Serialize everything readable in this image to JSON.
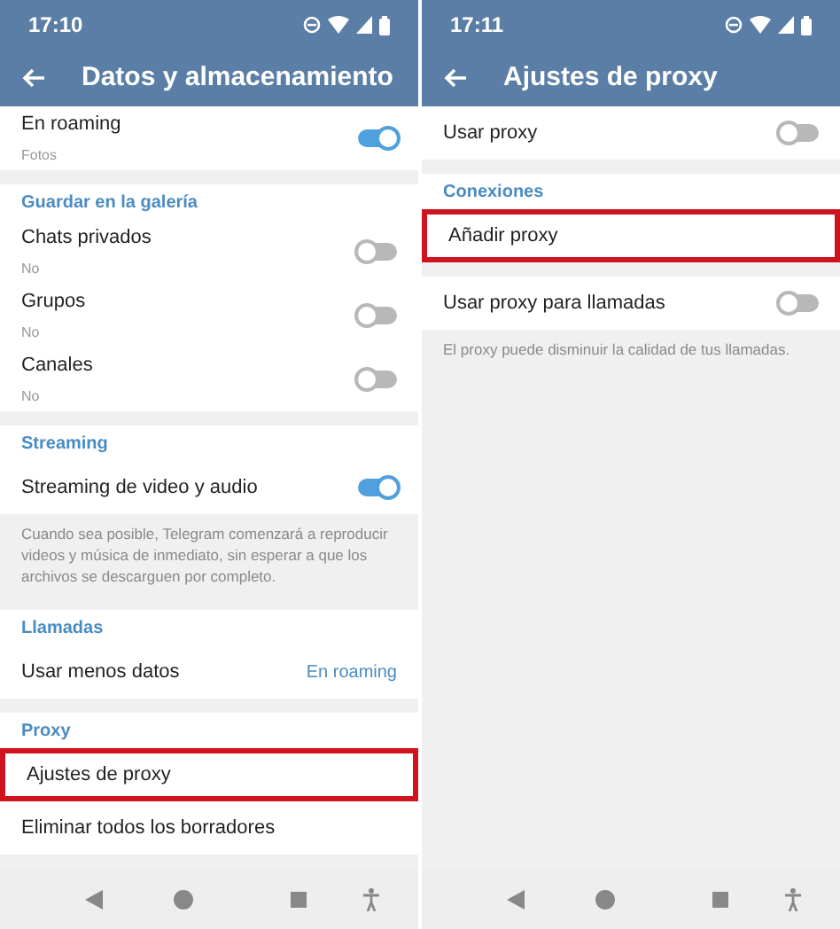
{
  "screens": [
    {
      "status_time": "17:10",
      "title": "Datos y almacenamiento",
      "sections": [
        {
          "rows": [
            {
              "kind": "toggle",
              "label": "En roaming",
              "sub": "Fotos",
              "on": true,
              "highlighted": false
            }
          ]
        },
        {
          "header": "Guardar en la galería",
          "rows": [
            {
              "kind": "toggle",
              "label": "Chats privados",
              "sub": "No",
              "on": false,
              "highlighted": false
            },
            {
              "kind": "toggle",
              "label": "Grupos",
              "sub": "No",
              "on": false,
              "highlighted": false
            },
            {
              "kind": "toggle",
              "label": "Canales",
              "sub": "No",
              "on": false,
              "highlighted": false
            }
          ]
        },
        {
          "header": "Streaming",
          "rows": [
            {
              "kind": "toggle",
              "label": "Streaming de video y audio",
              "on": true,
              "highlighted": false
            }
          ],
          "footer": "Cuando sea posible, Telegram comenzará a reproducir videos y música de inmediato, sin esperar a que los archivos se descarguen por completo."
        },
        {
          "header": "Llamadas",
          "rows": [
            {
              "kind": "value",
              "label": "Usar menos datos",
              "value": "En roaming",
              "highlighted": false
            }
          ]
        },
        {
          "header": "Proxy",
          "rows": [
            {
              "kind": "plain",
              "label": "Ajustes de proxy",
              "highlighted": true
            },
            {
              "kind": "plain",
              "label": "Eliminar todos los borradores",
              "highlighted": false
            }
          ]
        }
      ]
    },
    {
      "status_time": "17:11",
      "title": "Ajustes de proxy",
      "sections": [
        {
          "rows": [
            {
              "kind": "toggle",
              "label": "Usar proxy",
              "on": false,
              "highlighted": false
            }
          ]
        },
        {
          "header": "Conexiones",
          "rows": [
            {
              "kind": "plain",
              "label": "Añadir proxy",
              "highlighted": true
            }
          ]
        },
        {
          "rows": [
            {
              "kind": "toggle",
              "label": "Usar proxy para llamadas",
              "on": false,
              "highlighted": false
            }
          ],
          "footer": "El proxy puede disminuir la calidad de tus llamadas."
        }
      ]
    }
  ]
}
